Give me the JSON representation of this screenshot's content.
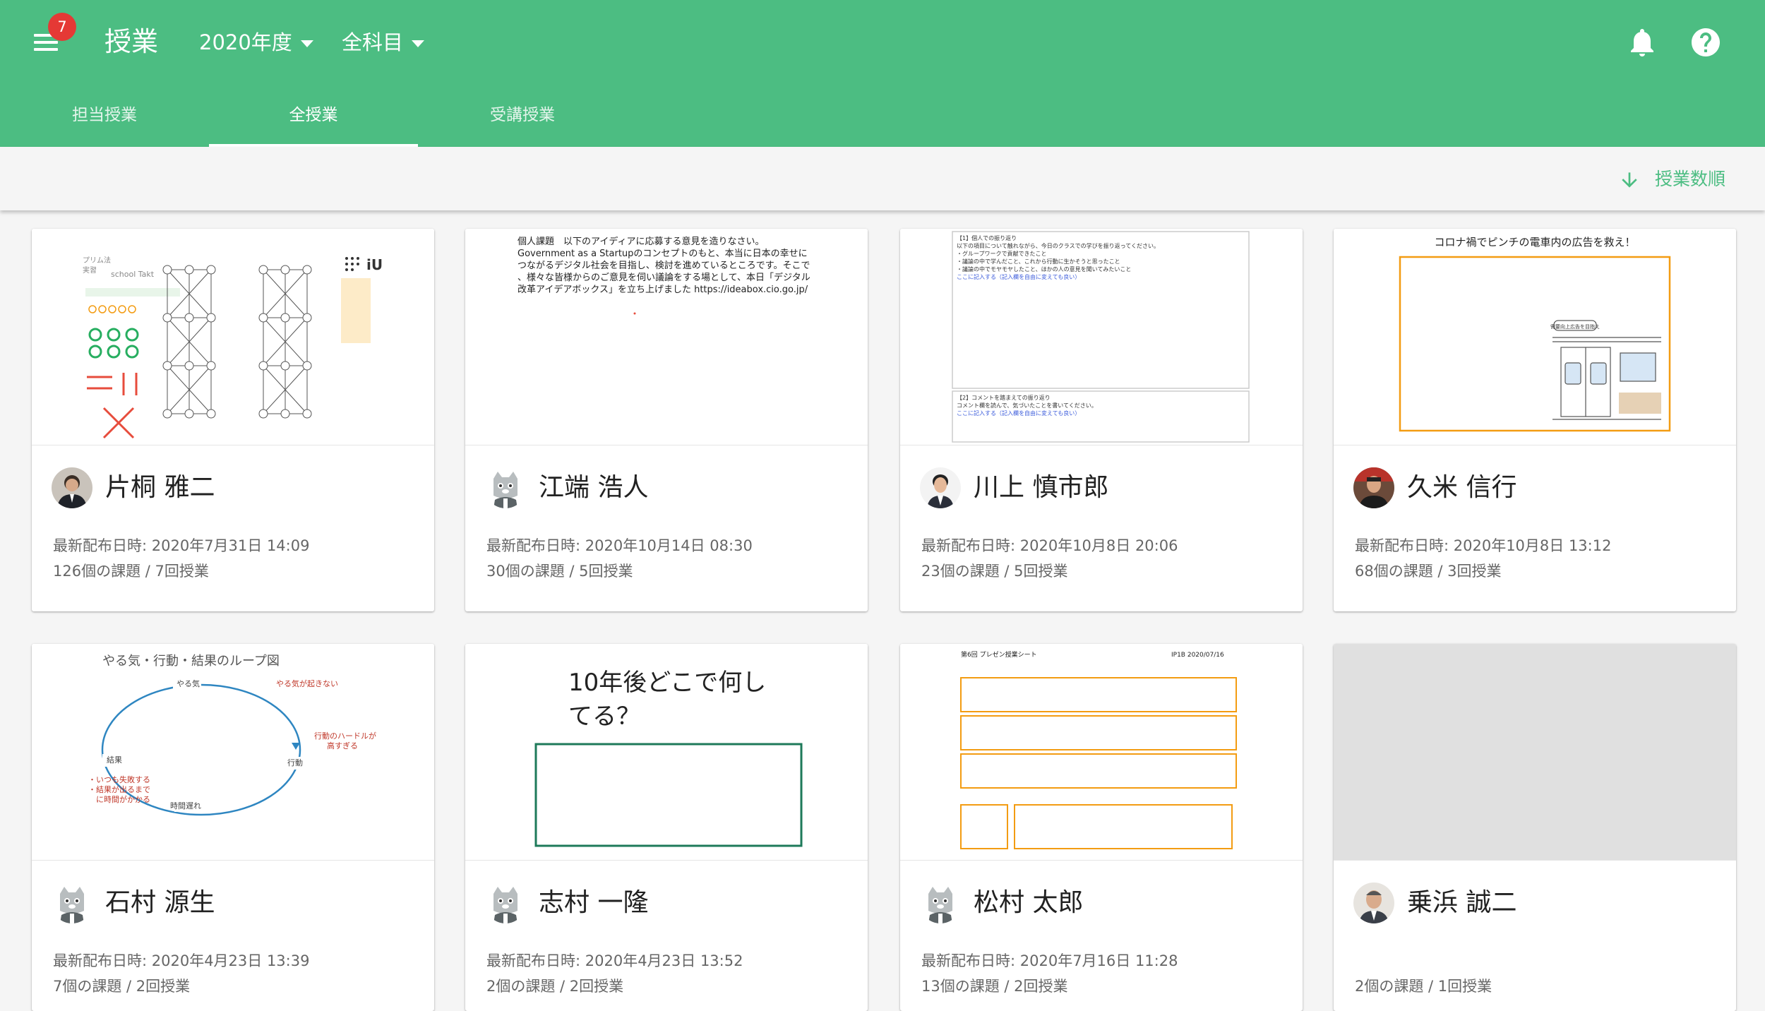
{
  "header": {
    "badge_count": "7",
    "title": "授業",
    "year_select": "2020年度",
    "subject_select": "全科目",
    "accent_color": "#4cbd82",
    "icons": [
      "menu-icon",
      "notification-bell-icon",
      "help-icon"
    ]
  },
  "tabs": [
    {
      "label": "担当授業",
      "active": false
    },
    {
      "label": "全授業",
      "active": true
    },
    {
      "label": "受講授業",
      "active": false
    }
  ],
  "sort": {
    "label": "授業数順",
    "icon": "arrow-down-icon"
  },
  "cards": [
    {
      "teacher": "片桐 雅二",
      "latest": "最新配布日時: 2020年7月31日 14:09",
      "counts": "126個の課題 / 7回授業"
    },
    {
      "teacher": "江端 浩人",
      "latest": "最新配布日時: 2020年10月14日 08:30",
      "counts": "30個の課題 / 5回授業",
      "thumb_text": [
        "個人課題　以下のアイディアに応募する意見を造りなさい。",
        "Government as a Startupのコンセプトのもと、本当に日本の幸せに",
        "つながるデジタル社会を目指し、検討を進めているところです。そこで",
        "、様々な皆様からのご意見を伺い議論をする場として、本日「デジタル",
        "改革アイデアボックス」を立ち上げました https://ideabox.cio.go.jp/"
      ]
    },
    {
      "teacher": "川上 慎市郎",
      "latest": "最新配布日時: 2020年10月8日 20:06",
      "counts": "23個の課題 / 5回授業",
      "thumb_text": [
        "【1】個人での振り返り",
        "以下の項目について触れながら、今日のクラスでの学びを振り返ってください。",
        "・グループワークで貢献できたこと",
        "・議論の中で学んだこと、これから行動に生かそうと思ったこと",
        "・議論の中でモヤモヤしたこと、ほかの人の意見を聞いてみたいこと",
        "ここに記入する（記入欄を自由に変えても良い）",
        "【2】コメントを踏まえての振り返り",
        "コメント欄を読んで、気づいたことを書いてください。",
        "ここに記入する（記入欄を自由に変えても良い）"
      ]
    },
    {
      "teacher": "久米 信行",
      "latest": "最新配布日時: 2020年10月8日 13:12",
      "counts": "68個の課題 / 3回授業",
      "thumb_text": [
        "コロナ禍でピンチの電車内の広告を救え！",
        "需要向上広告を目指え"
      ]
    },
    {
      "teacher": "石村 源生",
      "latest": "最新配布日時: 2020年4月23日 13:39",
      "counts": "7個の課題 / 2回授業",
      "thumb_text": [
        "やる気・行動・結果のループ図",
        "やる気",
        "やる気が起きない",
        "行動のハードルが",
        "高すぎる",
        "行動",
        "結果",
        "時間遅れ",
        "・いつも失敗する",
        "・結果が出るまで",
        "　に時間がかかる"
      ]
    },
    {
      "teacher": "志村 一隆",
      "latest": "最新配布日時: 2020年4月23日 13:52",
      "counts": "2個の課題 / 2回授業",
      "thumb_text": [
        "10年後どこで何し",
        "てる？"
      ]
    },
    {
      "teacher": "松村 太郎",
      "latest": "最新配布日時: 2020年7月16日 11:28",
      "counts": "13個の課題 / 2回授業",
      "thumb_text": [
        "第6回 プレゼン授業シート",
        "IP1B 2020/07/16"
      ]
    },
    {
      "teacher": "乗浜 誠二",
      "latest": "",
      "counts": "2個の課題 / 1回授業"
    }
  ]
}
